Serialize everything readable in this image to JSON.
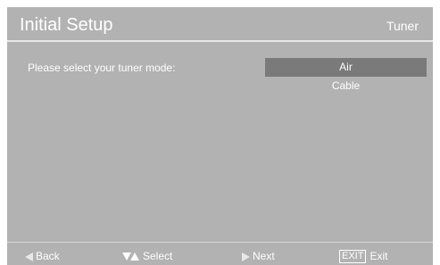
{
  "header": {
    "title": "Initial Setup",
    "section": "Tuner"
  },
  "body": {
    "prompt": "Please select your tuner mode:",
    "options": [
      "Air",
      "Cable"
    ],
    "selected_index": 0
  },
  "footer": {
    "back_label": "Back",
    "select_label": "Select",
    "next_label": "Next",
    "exit_key": "EXIT",
    "exit_label": "Exit"
  },
  "colors": {
    "panel": "#b2b2b2",
    "highlight": "#7a7a7a",
    "text": "#ffffff"
  },
  "icons": {
    "back": "left-triangle-icon",
    "select": "up-down-arrows-icon",
    "next": "right-triangle-icon"
  }
}
